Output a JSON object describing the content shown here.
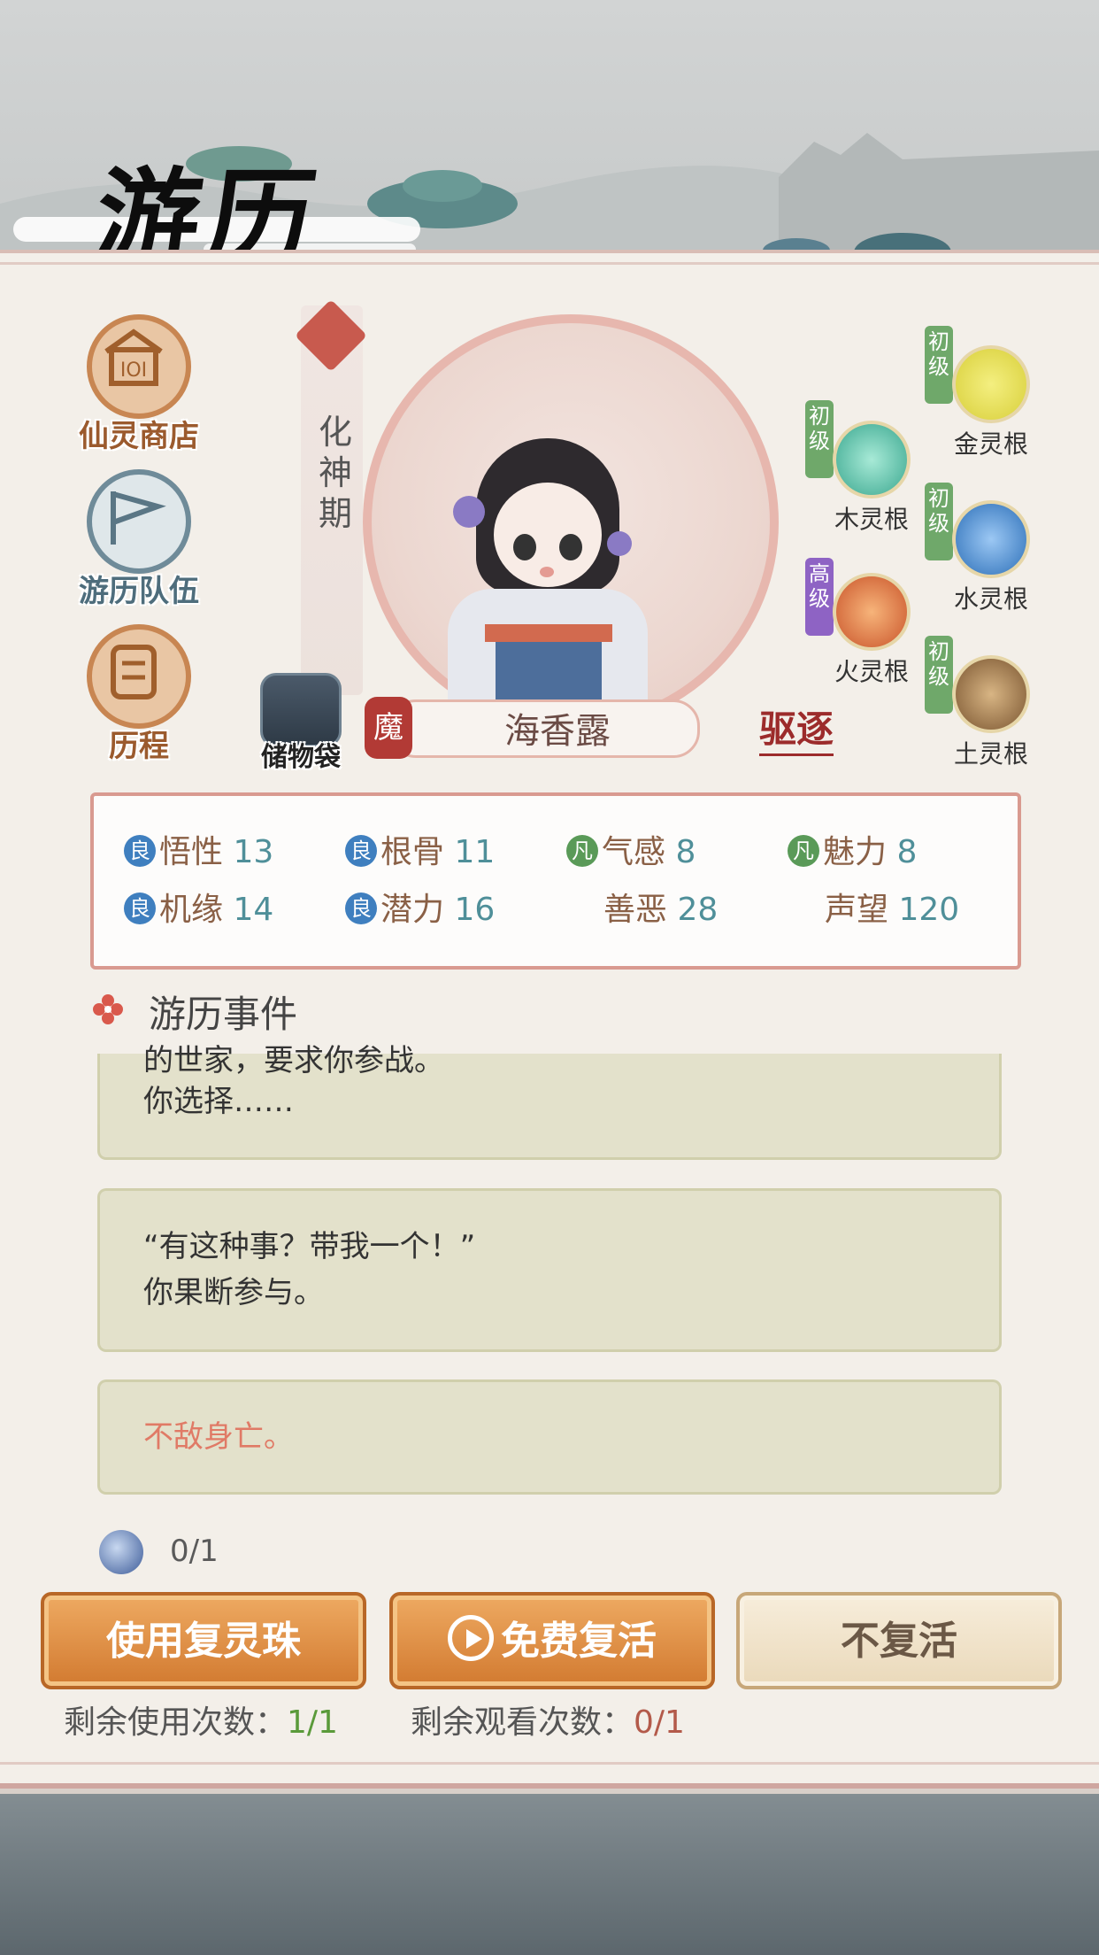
{
  "header": {
    "title": "游历"
  },
  "menu": [
    {
      "label": "仙灵商店",
      "icon": "shop-icon"
    },
    {
      "label": "游历队伍",
      "icon": "team-flag-icon"
    },
    {
      "label": "历程",
      "icon": "scroll-icon"
    }
  ],
  "character": {
    "realm": "化神期",
    "name": "海香露",
    "seal": "魔",
    "expel_label": "驱逐",
    "storage_label": "储物袋"
  },
  "spirit_roots": [
    {
      "grade": "初级",
      "label": "金灵根",
      "color": "#d8cf3a"
    },
    {
      "grade": "初级",
      "label": "木灵根",
      "color": "#3aa78f"
    },
    {
      "grade": "初级",
      "label": "水灵根",
      "color": "#2c6fb8"
    },
    {
      "grade": "高级",
      "label": "火灵根",
      "color": "#c9542a"
    },
    {
      "grade": "初级",
      "label": "土灵根",
      "color": "#7a5530"
    }
  ],
  "stats": [
    {
      "grade": "良",
      "name": "悟性",
      "value": "13"
    },
    {
      "grade": "良",
      "name": "根骨",
      "value": "11"
    },
    {
      "grade": "凡",
      "name": "气感",
      "value": "8"
    },
    {
      "grade": "凡",
      "name": "魅力",
      "value": "8"
    },
    {
      "grade": "良",
      "name": "机缘",
      "value": "14"
    },
    {
      "grade": "良",
      "name": "潜力",
      "value": "16"
    },
    {
      "grade": "",
      "name": "善恶",
      "value": "28"
    },
    {
      "grade": "",
      "name": "声望",
      "value": "120"
    }
  ],
  "events": {
    "title": "游历事件",
    "card1_line1": "的世家，要求你参战。",
    "card1_line2": "你选择……",
    "card2_line1": "“有这种事？带我一个！”",
    "card2_line2": "你果断参与。",
    "card3_line1": "不敌身亡。"
  },
  "revive": {
    "pearl_count": "0/1",
    "use_pearl_label": "使用复灵珠",
    "free_revive_label": "免费复活",
    "no_revive_label": "不复活",
    "remain_use_label": "剩余使用次数：",
    "remain_use_value": "1/1",
    "remain_watch_label": "剩余观看次数：",
    "remain_watch_value": "0/1"
  },
  "colors": {
    "accent_red": "#c85a4e",
    "good_grade": "#3f7fbf",
    "common_grade": "#5a9a58",
    "value_teal": "#4f8f99",
    "death_text": "#e07a66"
  }
}
